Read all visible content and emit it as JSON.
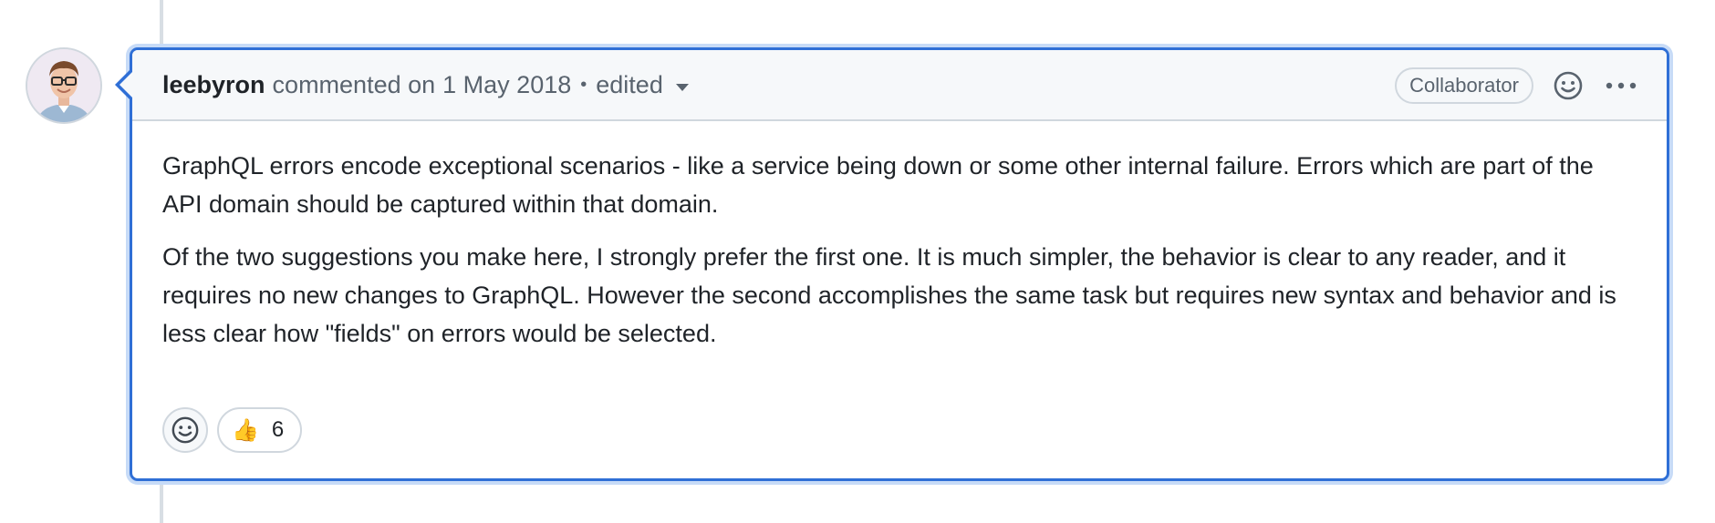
{
  "comment": {
    "author": "leebyron",
    "action": "commented on",
    "date": "1 May 2018",
    "separator": "•",
    "edited_label": "edited",
    "role_badge": "Collaborator",
    "paragraphs": [
      "GraphQL errors encode exceptional scenarios - like a service being down or some other internal failure. Errors which are part of the API domain should be captured within that domain.",
      "Of the two suggestions you make here, I strongly prefer the first one. It is much simpler, the behavior is clear to any reader, and it requires no new changes to GraphQL. However the second accomplishes the same task but requires new syntax and behavior and is less clear how \"fields\" on errors would be selected."
    ],
    "reactions": [
      {
        "emoji": "👍",
        "count": "6"
      }
    ]
  },
  "icons": {
    "avatar": "avatar-image",
    "add_reaction": "smiley-icon",
    "header_reaction": "smiley-icon",
    "more_options": "kebab-horizontal-icon",
    "edited_dropdown": "triangle-down-icon"
  },
  "colors": {
    "focus_border": "#2f6fd6",
    "header_bg": "#f6f8fa",
    "muted_text": "#59636e",
    "border": "#d0d7de"
  }
}
